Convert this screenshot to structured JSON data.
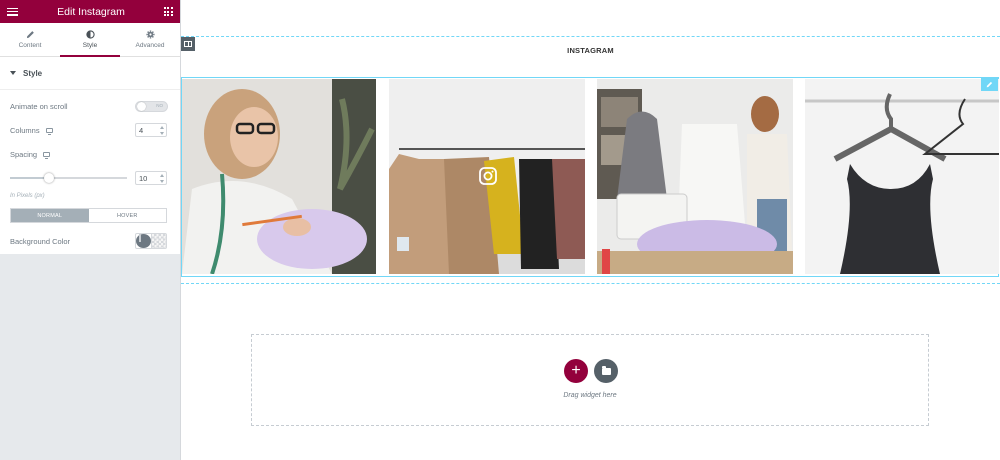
{
  "editor": {
    "title": "Edit Instagram",
    "tabs": [
      {
        "label": "Content",
        "icon": "pencil-icon",
        "active": false
      },
      {
        "label": "Style",
        "icon": "half-circle-icon",
        "active": true
      },
      {
        "label": "Advanced",
        "icon": "gear-icon",
        "active": false
      }
    ],
    "section_title": "Style",
    "controls": {
      "animate_on_scroll": {
        "label": "Animate on scroll",
        "toggle_text": "NO",
        "enabled": false
      },
      "columns": {
        "label": "Columns",
        "value": "4"
      },
      "spacing": {
        "label": "Spacing",
        "value": "10",
        "slider_fraction": 0.33
      },
      "units_hint": "In Pixels (px)",
      "state_tabs": [
        "NORMAL",
        "HOVER"
      ],
      "background_color": {
        "label": "Background Color"
      }
    },
    "accent_color": "#93003c"
  },
  "canvas": {
    "heading": "INSTAGRAM",
    "photos": [
      "tailor-sewing-photo",
      "coats-on-rack-photo",
      "dressmaker-studio-photo",
      "black-dress-on-hanger-photo"
    ],
    "dropzone_text": "Drag widget here"
  }
}
